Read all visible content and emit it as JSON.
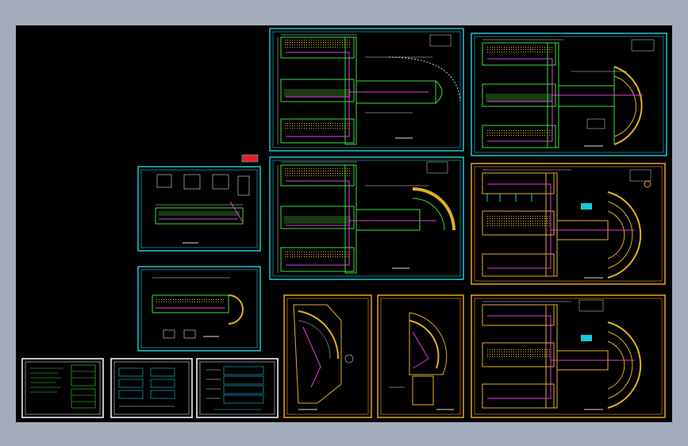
{
  "app": {
    "background_color": "#a3acba",
    "canvas_color": "#000000"
  },
  "colors": {
    "frame_cyan": "#19c9d6",
    "frame_orange": "#e8a21a",
    "frame_white": "#ffffff",
    "wall_green": "#36e23a",
    "wire_magenta": "#e23ae6",
    "room_fill_yellow": "#e0b020",
    "dim_white": "#dcdcdc",
    "accent_red": "#e8202a",
    "text_green": "#2ee02e"
  },
  "drawing_sheets": [
    {
      "id": "sheet-top-middle",
      "border": "cyan",
      "plan": "t-wing",
      "title_label": ""
    },
    {
      "id": "sheet-top-right",
      "border": "cyan",
      "plan": "t-wing-round",
      "title_label": ""
    },
    {
      "id": "sheet-middle-middle",
      "border": "cyan",
      "plan": "t-wing-arc",
      "title_label": ""
    },
    {
      "id": "sheet-middle-right",
      "border": "orange",
      "plan": "t-wing-round",
      "title_label": ""
    },
    {
      "id": "sheet-small-upper",
      "border": "cyan",
      "plan": "stair-details",
      "title_label": ""
    },
    {
      "id": "sheet-small-lower",
      "border": "cyan",
      "plan": "corridor",
      "title_label": ""
    },
    {
      "id": "sheet-fan-left",
      "border": "orange",
      "plan": "fan",
      "title_label": ""
    },
    {
      "id": "sheet-fan-right",
      "border": "orange",
      "plan": "fan",
      "title_label": ""
    },
    {
      "id": "sheet-bottom-right",
      "border": "orange",
      "plan": "t-wing-round",
      "title_label": ""
    },
    {
      "id": "sheet-legend",
      "border": "white",
      "plan": "legend",
      "title_label": ""
    },
    {
      "id": "sheet-schedule",
      "border": "white",
      "plan": "schedule",
      "title_label": ""
    },
    {
      "id": "sheet-riser",
      "border": "white",
      "plan": "riser",
      "title_label": ""
    }
  ]
}
